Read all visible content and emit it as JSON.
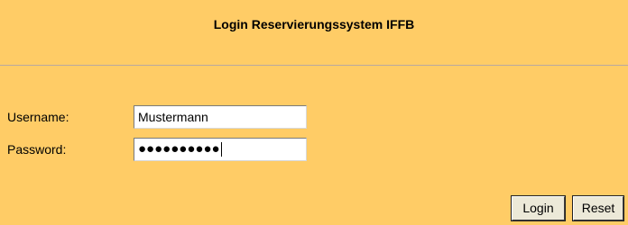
{
  "header": {
    "title": "Login Reservierungssystem IFFB"
  },
  "form": {
    "username_label": "Username:",
    "username_value": "Mustermann",
    "password_label": "Password:",
    "password_masked": "●●●●●●●●●●"
  },
  "buttons": {
    "login_label": "Login",
    "reset_label": "Reset"
  },
  "colors": {
    "background": "#ffcc66",
    "divider": "#b8a8a0"
  }
}
